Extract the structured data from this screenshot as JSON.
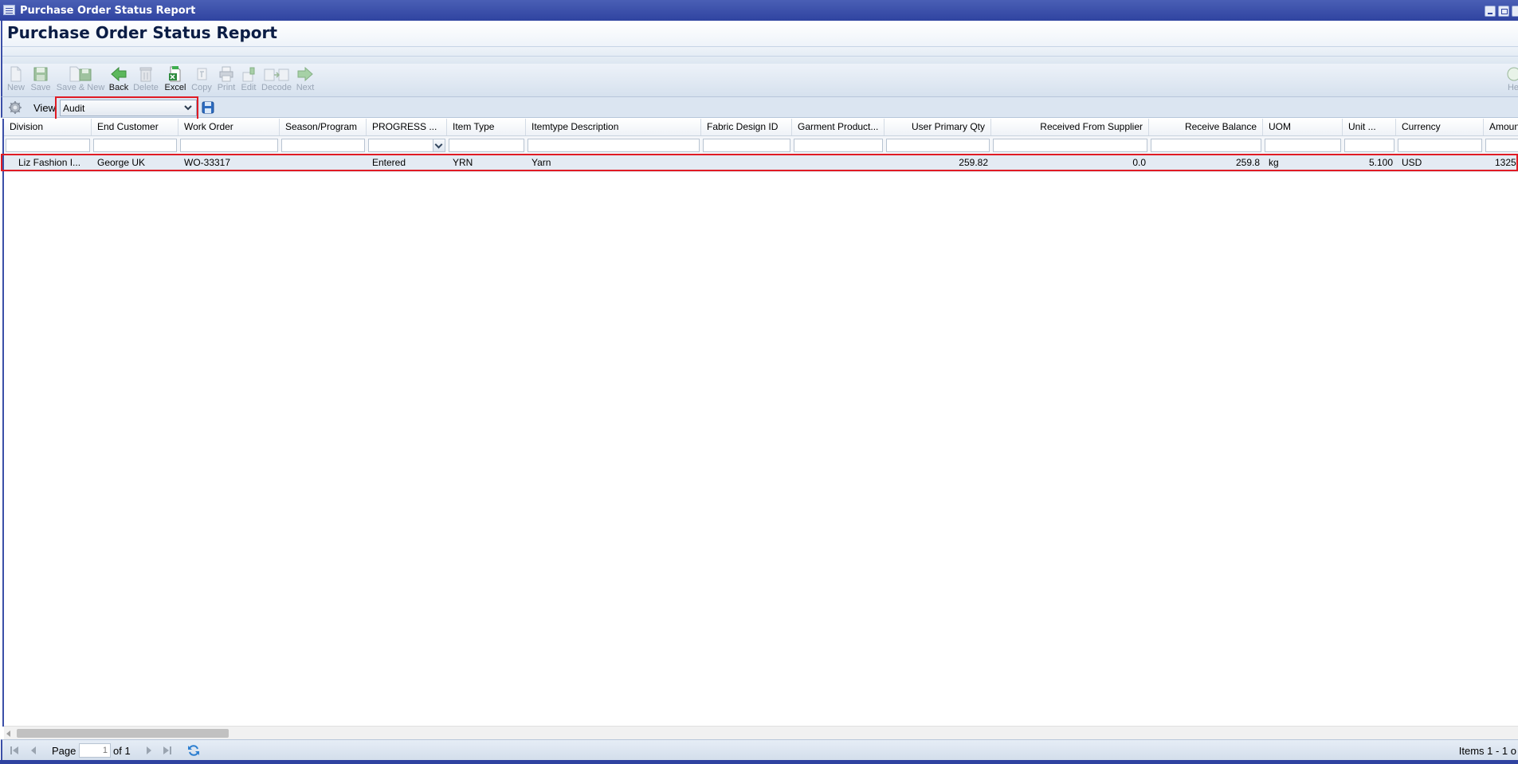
{
  "window": {
    "title": "Purchase Order Status Report"
  },
  "page": {
    "title": "Purchase Order Status Report"
  },
  "toolbar": {
    "new": "New",
    "save": "Save",
    "save_new": "Save & New",
    "back": "Back",
    "delete": "Delete",
    "excel": "Excel",
    "copy": "Copy",
    "print": "Print",
    "edit": "Edit",
    "decode": "Decode",
    "next": "Next",
    "help": "He"
  },
  "view": {
    "label": "View",
    "selected": "Audit"
  },
  "grid": {
    "columns": [
      "Division",
      "End Customer",
      "Work Order",
      "Season/Program",
      "PROGRESS ...",
      "Item Type",
      "Itemtype Description",
      "Fabric Design ID",
      "Garment Product...",
      "User Primary Qty",
      "Received From Supplier",
      "Receive Balance",
      "UOM",
      "Unit ...",
      "Currency",
      "Amoun"
    ],
    "rows": [
      {
        "division": "Liz Fashion I...",
        "end_customer": "George UK",
        "work_order": "WO-33317",
        "season_program": "",
        "progress": "Entered",
        "item_type": "YRN",
        "itemtype_description": "Yarn",
        "fabric_design_id": "",
        "garment_product": "",
        "user_primary_qty": "259.82",
        "received_from_supplier": "0.0",
        "receive_balance": "259.8",
        "uom": "kg",
        "unit": "5.100",
        "currency": "USD",
        "amount": "1325.0"
      }
    ]
  },
  "pager": {
    "page_label": "Page",
    "page_value": "1",
    "of_label": "of 1",
    "items_text": "Items 1 - 1 o"
  },
  "colors": {
    "titlebar": "#2f43a0",
    "highlight": "#e01b24",
    "row_bg": "#e4ebf3"
  }
}
